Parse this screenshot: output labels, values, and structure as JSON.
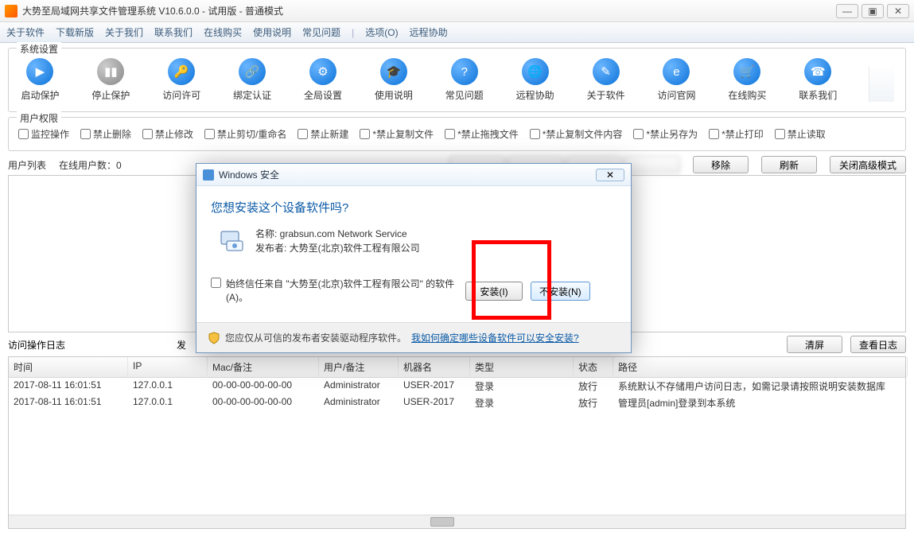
{
  "window": {
    "title": "大势至局域网共享文件管理系统 V10.6.0.0 - 试用版 - 普通模式"
  },
  "menu": [
    "关于软件",
    "下载新版",
    "关于我们",
    "联系我们",
    "在线购买",
    "使用说明",
    "常见问题",
    "|",
    "选项(O)",
    "远程协助"
  ],
  "groups": {
    "system": "系统设置",
    "perm": "用户权限"
  },
  "tools": [
    {
      "label": "启动保护",
      "enabled": true
    },
    {
      "label": "停止保护",
      "enabled": false
    },
    {
      "label": "访问许可",
      "enabled": true
    },
    {
      "label": "绑定认证",
      "enabled": true
    },
    {
      "label": "全局设置",
      "enabled": true
    },
    {
      "label": "使用说明",
      "enabled": true
    },
    {
      "label": "常见问题",
      "enabled": true
    },
    {
      "label": "远程协助",
      "enabled": true
    },
    {
      "label": "关于软件",
      "enabled": true
    },
    {
      "label": "访问官网",
      "enabled": true
    },
    {
      "label": "在线购买",
      "enabled": true
    },
    {
      "label": "联系我们",
      "enabled": true
    }
  ],
  "perms": [
    "监控操作",
    "禁止删除",
    "禁止修改",
    "禁止剪切/重命名",
    "禁止新建",
    "*禁止复制文件",
    "*禁止拖拽文件",
    "*禁止复制文件内容",
    "*禁止另存为",
    "*禁止打印",
    "禁止读取"
  ],
  "listbar": {
    "userlist": "用户列表",
    "online": "在线用户数：0",
    "remove": "移除",
    "refresh": "刷新",
    "closeadv": "关闭高级模式"
  },
  "logbar": {
    "title": "访问操作日志",
    "sendto": "发",
    "clear": "清屏",
    "view": "查看日志"
  },
  "logcols": [
    "时间",
    "IP",
    "Mac/备注",
    "用户/备注",
    "机器名",
    "类型",
    "状态",
    "路径"
  ],
  "logrows": [
    {
      "c": [
        "2017-08-11 16:01:51",
        "127.0.0.1",
        "00-00-00-00-00-00",
        "Administrator",
        "USER-2017",
        "登录",
        "放行",
        "系统默认不存储用户访问日志，如需记录请按照说明安装数据库"
      ]
    },
    {
      "c": [
        "2017-08-11 16:01:51",
        "127.0.0.1",
        "00-00-00-00-00-00",
        "Administrator",
        "USER-2017",
        "登录",
        "放行",
        "管理员[admin]登录到本系统"
      ]
    }
  ],
  "dialog": {
    "title": "Windows 安全",
    "question": "您想安装这个设备软件吗?",
    "name_label": "名称: ",
    "name_value": "grabsun.com Network Service",
    "pub_label": "发布者: ",
    "pub_value": "大势至(北京)软件工程有限公司",
    "trust": "始终信任来自 \"大势至(北京)软件工程有限公司\" 的软件(A)。",
    "install": "安装(I)",
    "noinstall": "不安装(N)",
    "footer_text": "您应仅从可信的发布者安装驱动程序软件。",
    "footer_link": "我如何确定哪些设备软件可以安全安装?",
    "close": "✕"
  }
}
